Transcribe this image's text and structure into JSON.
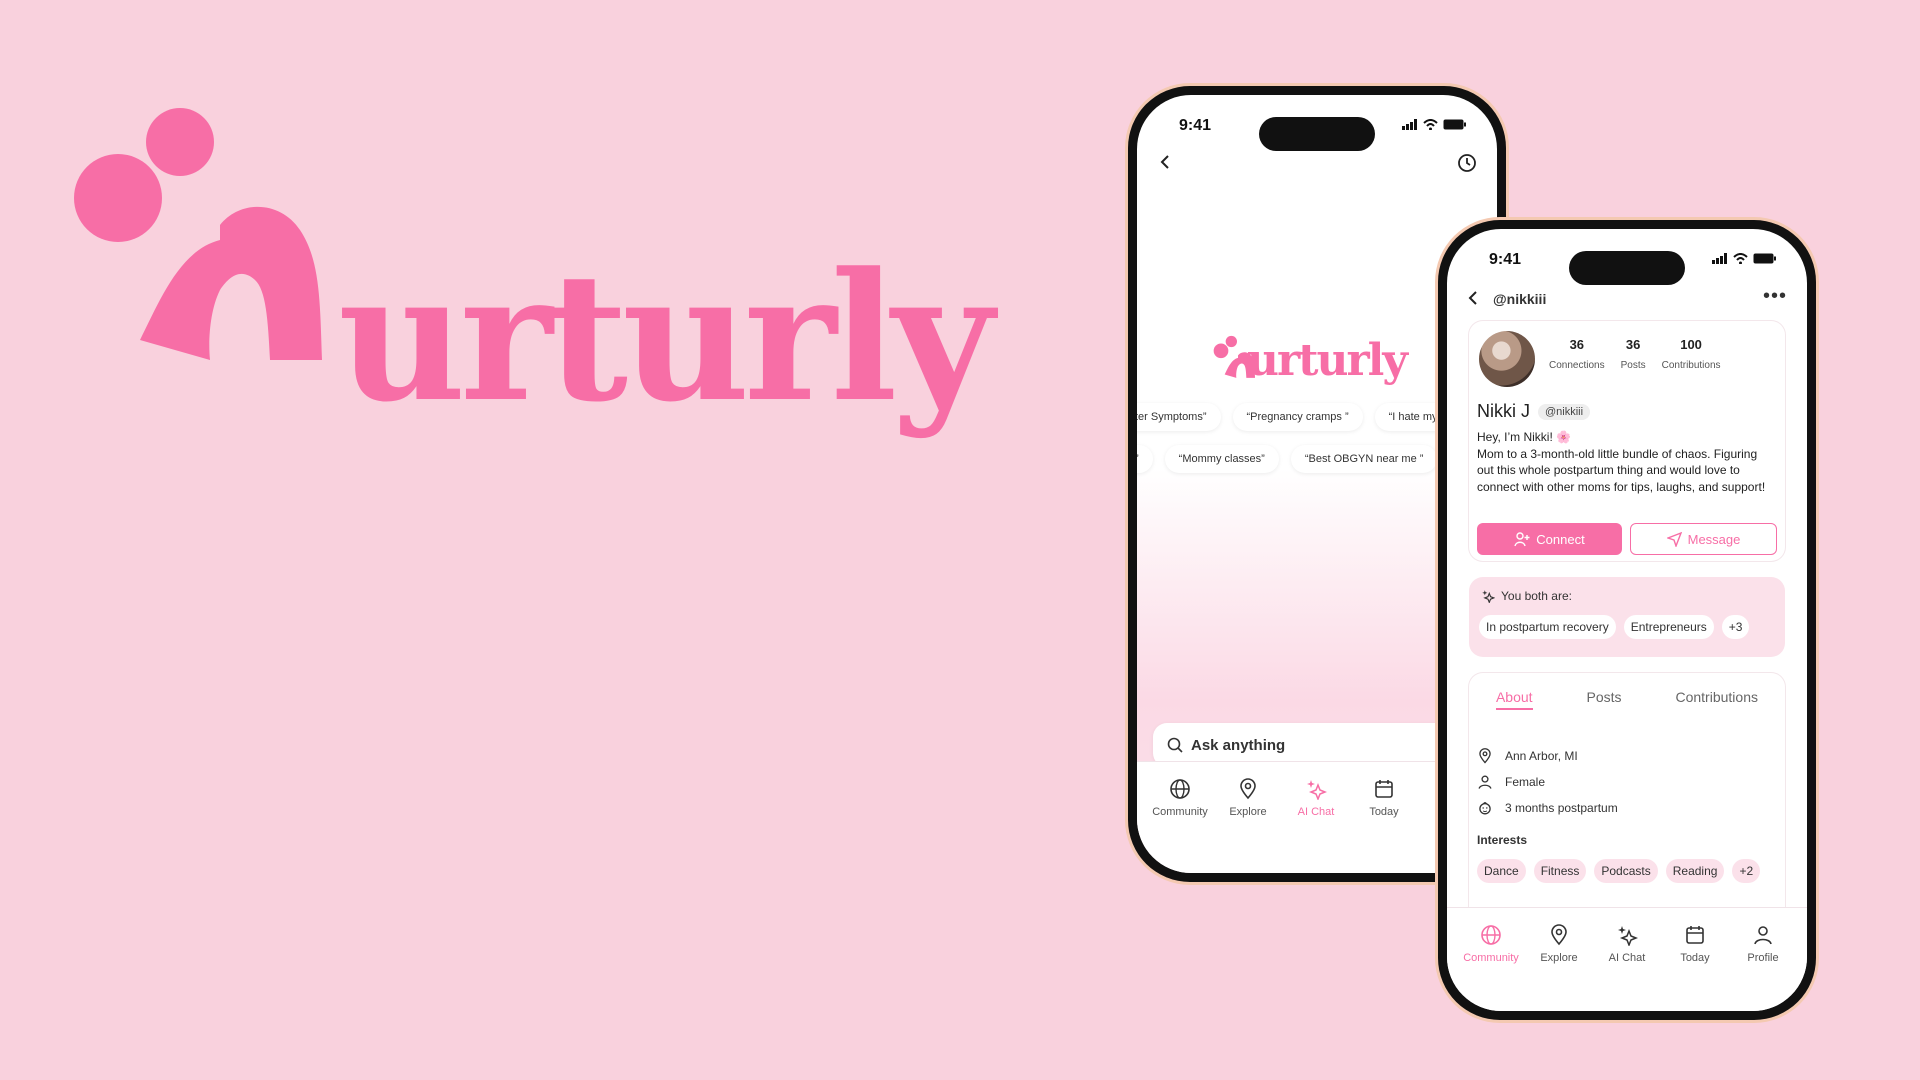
{
  "brand": {
    "word": "urturly",
    "color": "#f76ea6"
  },
  "phone1": {
    "time": "9:41",
    "logo_word": "urturly",
    "prompts_row1": [
      "ter Symptoms”",
      "“Pregnancy cramps ”",
      "“I hate my"
    ],
    "prompts_row2": [
      "”",
      "“Mommy classes”",
      "“Best OBGYN near me ”"
    ],
    "search_placeholder": "Ask anything",
    "tabs": [
      "Community",
      "Explore",
      "AI Chat",
      "Today",
      "P"
    ]
  },
  "phone2": {
    "time": "9:41",
    "handle": "@nikkiii",
    "more": "•••",
    "stats": [
      {
        "value": "36",
        "label": "Connections"
      },
      {
        "value": "36",
        "label": "Posts"
      },
      {
        "value": "100",
        "label": "Contributions"
      }
    ],
    "name": "Nikki J",
    "name_badge": "@nikkiii",
    "bio_line1": "Hey, I’m Nikki! 🌸",
    "bio_line2": "Mom to a 3-month-old little bundle of chaos. Figuring out this whole postpartum thing and would love to connect with other moms for tips, laughs, and support!",
    "connect_label": "Connect",
    "message_label": "Message",
    "common_title": "You both are:",
    "common_tags": [
      "In postpartum recovery",
      "Entrepreneurs",
      "+3"
    ],
    "profile_tabs": [
      "About",
      "Posts",
      "Contributions"
    ],
    "location": "Ann Arbor, MI",
    "gender": "Female",
    "stage": "3 months postpartum",
    "interests_label": "Interests",
    "interests": [
      "Dance",
      "Fitness",
      "Podcasts",
      "Reading",
      "+2"
    ],
    "tabs": [
      "Community",
      "Explore",
      "AI Chat",
      "Today",
      "Profile"
    ]
  }
}
